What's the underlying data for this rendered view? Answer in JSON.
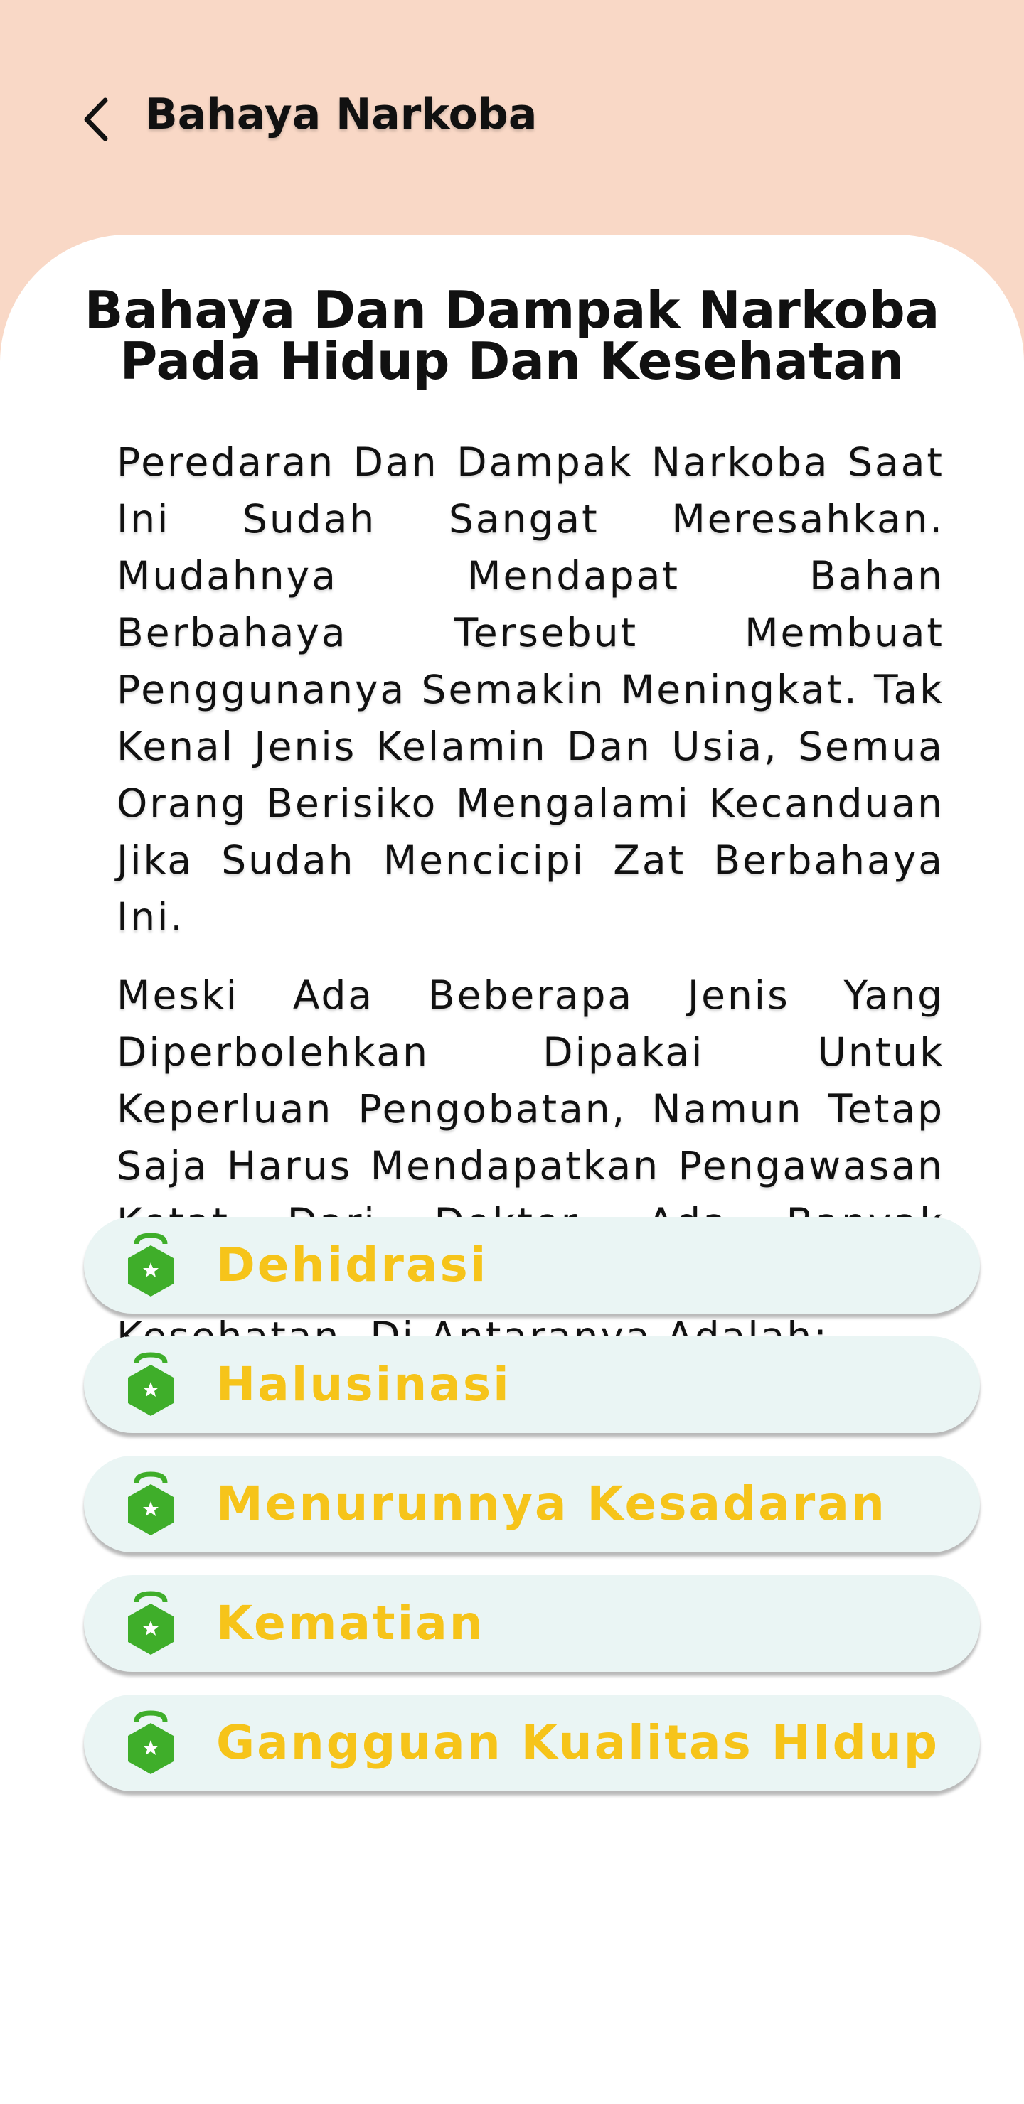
{
  "header": {
    "back_icon": "chevron-left-icon",
    "title": "Bahaya Narkoba"
  },
  "article": {
    "heading": "Bahaya Dan Dampak Narkoba Pada Hidup Dan Kesehatan",
    "paragraph1": "Peredaran Dan Dampak Narkoba Saat Ini Sudah Sangat Meresahkan. Mudahnya Mendapat Bahan Berbahaya Tersebut Membuat Penggunanya Semakin Meningkat. Tak Kenal Jenis Kelamin Dan Usia, Semua Orang Berisiko Mengalami Kecanduan Jika Sudah Mencicipi Zat Berbahaya Ini.",
    "paragraph2": "Meski Ada Beberapa Jenis Yang Diperbolehkan Dipakai Untuk Keperluan Pengobatan, Namun Tetap Saja Harus Mendapatkan Pengawasan Ketat Dari Dokter. Ada Banyak Bahaya Narkoba Bagi Hidup Dan Kesehatan, Di Antaranya Adalah:"
  },
  "dangers": {
    "icon": "green-badge-icon",
    "items": [
      {
        "label": "Dehidrasi"
      },
      {
        "label": "Halusinasi"
      },
      {
        "label": "Menurunnya Kesadaran"
      },
      {
        "label": "Kematian"
      },
      {
        "label": "Gangguan Kualitas HIdup"
      }
    ]
  },
  "colors": {
    "header_bg": "#f9d8c6",
    "card_bg": "#ffffff",
    "pill_bg": "#eaf5f4",
    "label_text": "#f6c41a",
    "icon_green": "#3fae2a"
  }
}
